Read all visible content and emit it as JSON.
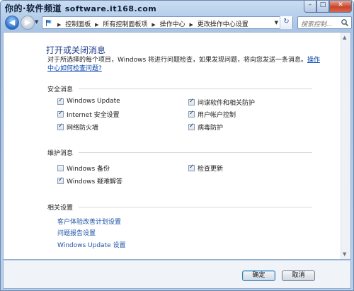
{
  "watermark": {
    "text": "你的·软件频道",
    "site": "software.it168.com"
  },
  "window_controls": {
    "minimize": "–",
    "maximize": "□",
    "close": "✕"
  },
  "breadcrumbs": [
    "控制面板",
    "所有控制面板项",
    "操作中心",
    "更改操作中心设置"
  ],
  "search": {
    "placeholder": "搜索控制..."
  },
  "page": {
    "title": "打开或关闭消息",
    "description": "对于所选择的每个项目，Windows 将进行问题检查，如果发现问题，将向您发送一条消息。",
    "link": "操作中心如何检查问题?"
  },
  "security": {
    "heading": "安全消息",
    "items": [
      {
        "label": "Windows Update",
        "checked": true
      },
      {
        "label": "间谍软件和相关防护",
        "checked": true
      },
      {
        "label": "Internet 安全设置",
        "checked": true
      },
      {
        "label": "用户帐户控制",
        "checked": true
      },
      {
        "label": "网络防火墙",
        "checked": true
      },
      {
        "label": "病毒防护",
        "checked": true
      }
    ]
  },
  "maintenance": {
    "heading": "维护消息",
    "items": [
      {
        "label": "Windows 备份",
        "checked": false
      },
      {
        "label": "检查更新",
        "checked": true
      },
      {
        "label": "Windows 疑难解答",
        "checked": true
      }
    ]
  },
  "related": {
    "heading": "相关设置",
    "links": [
      "客户体验改善计划设置",
      "问题报告设置",
      "Windows Update 设置"
    ]
  },
  "footer": {
    "ok": "确定",
    "cancel": "取消"
  },
  "colors": {
    "title": "#1e3c8f",
    "link": "#1e53a7",
    "window_frame": "#a9c4e5",
    "close_button": "#c9452d"
  }
}
